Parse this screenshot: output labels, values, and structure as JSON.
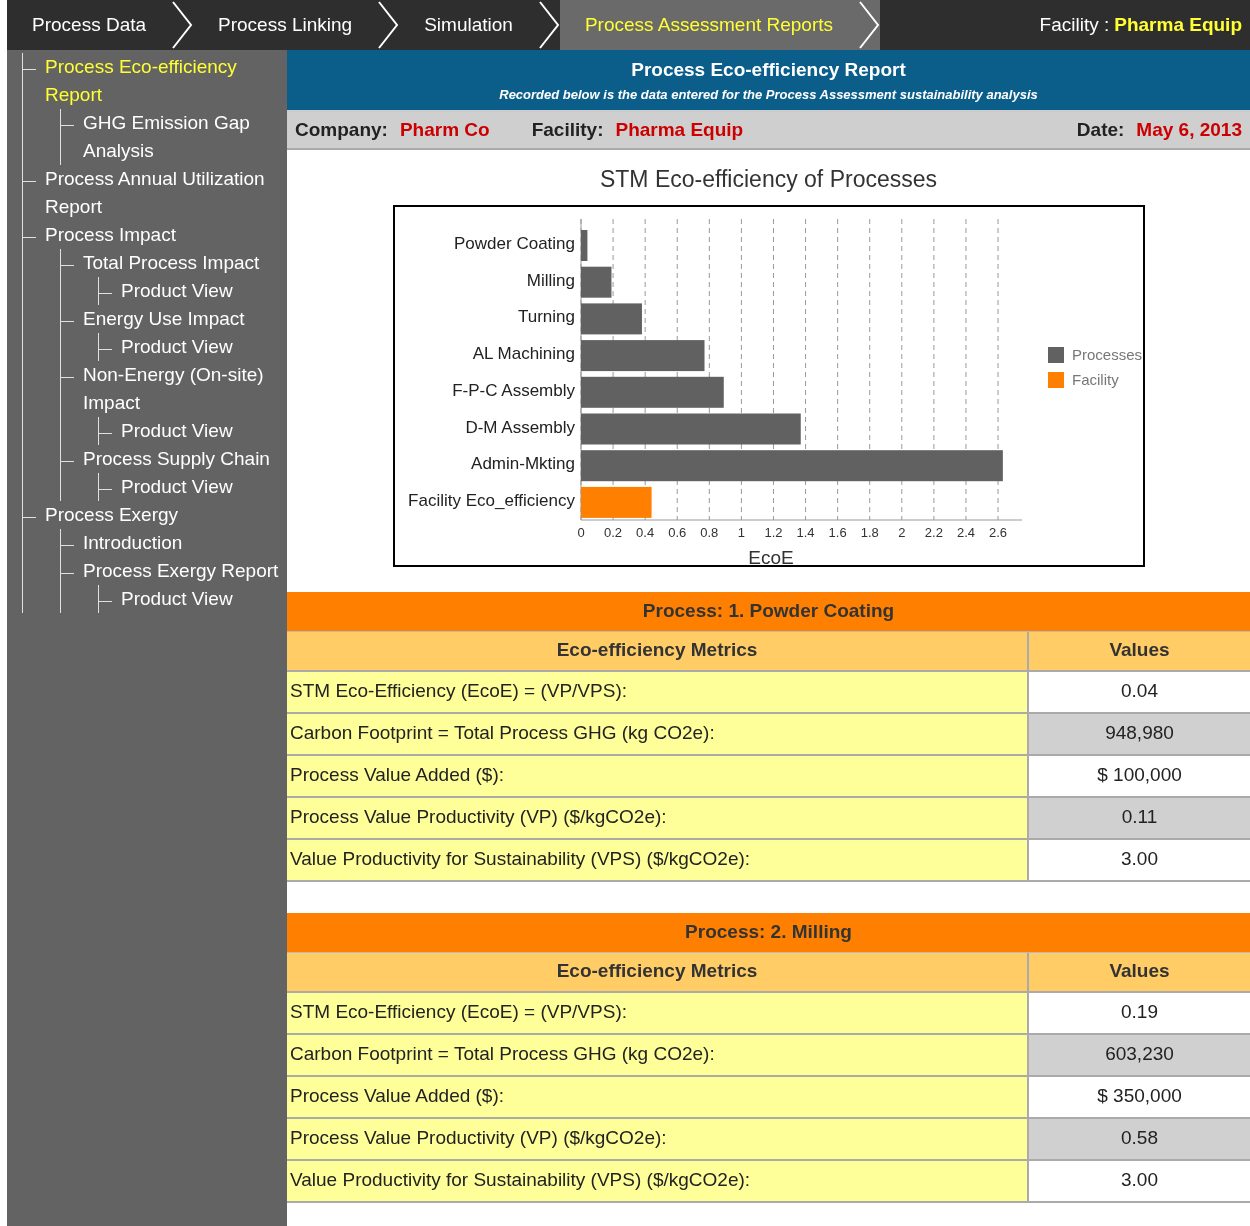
{
  "nav": {
    "tabs": [
      {
        "label": "Process Data",
        "selected": false
      },
      {
        "label": "Process Linking",
        "selected": false
      },
      {
        "label": "Simulation",
        "selected": false
      },
      {
        "label": "Process Assessment Reports",
        "selected": true
      }
    ],
    "facility_label": "Facility :",
    "facility_value": "Pharma Equip"
  },
  "sidebar": {
    "items": [
      {
        "label": "Process Eco-efficiency Report",
        "selected": true,
        "children": [
          {
            "label": "GHG Emission Gap Analysis",
            "selected": false
          }
        ]
      },
      {
        "label": "Process Annual Utilization Report",
        "selected": false
      },
      {
        "label": "Process Impact",
        "selected": false,
        "children": [
          {
            "label": "Total Process Impact",
            "selected": false,
            "children": [
              {
                "label": "Product View",
                "selected": false
              }
            ]
          },
          {
            "label": "Energy Use Impact",
            "selected": false,
            "children": [
              {
                "label": "Product View",
                "selected": false
              }
            ]
          },
          {
            "label": "Non-Energy (On-site) Impact",
            "selected": false,
            "children": [
              {
                "label": "Product View",
                "selected": false
              }
            ]
          },
          {
            "label": "Process Supply Chain",
            "selected": false,
            "children": [
              {
                "label": "Product View",
                "selected": false
              }
            ]
          }
        ]
      },
      {
        "label": "Process Exergy",
        "selected": false,
        "children": [
          {
            "label": "Introduction",
            "selected": false
          },
          {
            "label": "Process Exergy Report",
            "selected": false,
            "children": [
              {
                "label": "Product View",
                "selected": false
              }
            ]
          }
        ]
      }
    ]
  },
  "report": {
    "title": "Process Eco-efficiency Report",
    "subtitle": "Recorded below is the data entered for the Process Assessment sustainability analysis",
    "company_label": "Company:",
    "company": "Pharm Co",
    "facility_label": "Facility:",
    "facility": "Pharma Equip",
    "date_label": "Date:",
    "date": "May 6, 2013"
  },
  "chart_data": {
    "type": "bar",
    "orientation": "horizontal",
    "stacked": true,
    "title": "STM Eco-efficiency of Processes",
    "xlabel": "EcoE",
    "categories": [
      "Powder Coating",
      "Milling",
      "Turning",
      "AL Machining",
      "F-P-C Assembly",
      "D-M Assembly",
      "Admin-Mkting",
      "Facility Eco_efficiency"
    ],
    "series": [
      {
        "name": "Processes",
        "color": "#616161",
        "values": [
          0.04,
          0.19,
          0.38,
          0.77,
          0.89,
          1.37,
          2.63,
          null
        ]
      },
      {
        "name": "Facility",
        "color": "#ff8000",
        "values": [
          null,
          null,
          null,
          null,
          null,
          null,
          null,
          0.44
        ]
      }
    ],
    "xlim": [
      0,
      2.75
    ],
    "grid": true,
    "legend": true,
    "xticks": [
      0,
      0.2,
      0.4,
      0.6,
      0.8,
      1,
      1.2,
      1.4,
      1.6,
      1.8,
      2,
      2.2,
      2.4,
      2.6
    ]
  },
  "processes": [
    {
      "title": "Process: 1. Powder Coating",
      "metric_header": "Eco-efficiency Metrics",
      "value_header": "Values",
      "rows": [
        {
          "metric": "STM Eco-Efficiency (EcoE) = (VP/VPS):",
          "value": "0.04"
        },
        {
          "metric": "Carbon Footprint = Total Process GHG (kg CO2e):",
          "value": "948,980"
        },
        {
          "metric": "Process Value Added ($):",
          "value": "$ 100,000"
        },
        {
          "metric": "Process Value Productivity (VP) ($/kgCO2e):",
          "value": "0.11"
        },
        {
          "metric": "Value Productivity for Sustainability (VPS) ($/kgCO2e):",
          "value": "3.00"
        }
      ]
    },
    {
      "title": "Process: 2. Milling",
      "metric_header": "Eco-efficiency Metrics",
      "value_header": "Values",
      "rows": [
        {
          "metric": "STM Eco-Efficiency (EcoE) = (VP/VPS):",
          "value": "0.19"
        },
        {
          "metric": "Carbon Footprint = Total Process GHG (kg CO2e):",
          "value": "603,230"
        },
        {
          "metric": "Process Value Added ($):",
          "value": "$ 350,000"
        },
        {
          "metric": "Process Value Productivity (VP) ($/kgCO2e):",
          "value": "0.58"
        },
        {
          "metric": "Value Productivity for Sustainability (VPS) ($/kgCO2e):",
          "value": "3.00"
        }
      ]
    }
  ]
}
